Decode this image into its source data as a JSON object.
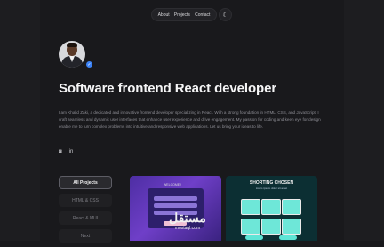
{
  "nav": {
    "items": [
      {
        "label": "About"
      },
      {
        "label": "Projects"
      },
      {
        "label": "Contact"
      }
    ],
    "theme_icon": "moon-icon"
  },
  "profile": {
    "verified_icon": "check-icon",
    "title": "Software frontend React developer",
    "bio": "I am Khalid Zaki, a dedicated and innovative frontend developer specializing in React. With a strong foundation in HTML, CSS, and JavaScript, I craft seamless and dynamic user interfaces that enhance user experience and drive engagement. My passion for coding and keen eye for design enable me to turn complex problems into intuitive and responsive web applications. Let us bring your ideas to life."
  },
  "socials": [
    {
      "icon": "github-icon",
      "glyph": "◙"
    },
    {
      "icon": "linkedin-icon",
      "glyph": "in"
    }
  ],
  "filters": [
    {
      "label": "All Projects",
      "active": true
    },
    {
      "label": "HTML & CSS"
    },
    {
      "label": "React & MUI"
    },
    {
      "label": "Next"
    }
  ],
  "projects": {
    "card1": {
      "header": "WELCOME !"
    },
    "card2": {
      "header": "SHORTING CHOSEN",
      "sub": "lorem ipsum dolor sit amet"
    }
  },
  "watermark": {
    "arabic": "مستقل",
    "latin": "mostaql.com"
  }
}
